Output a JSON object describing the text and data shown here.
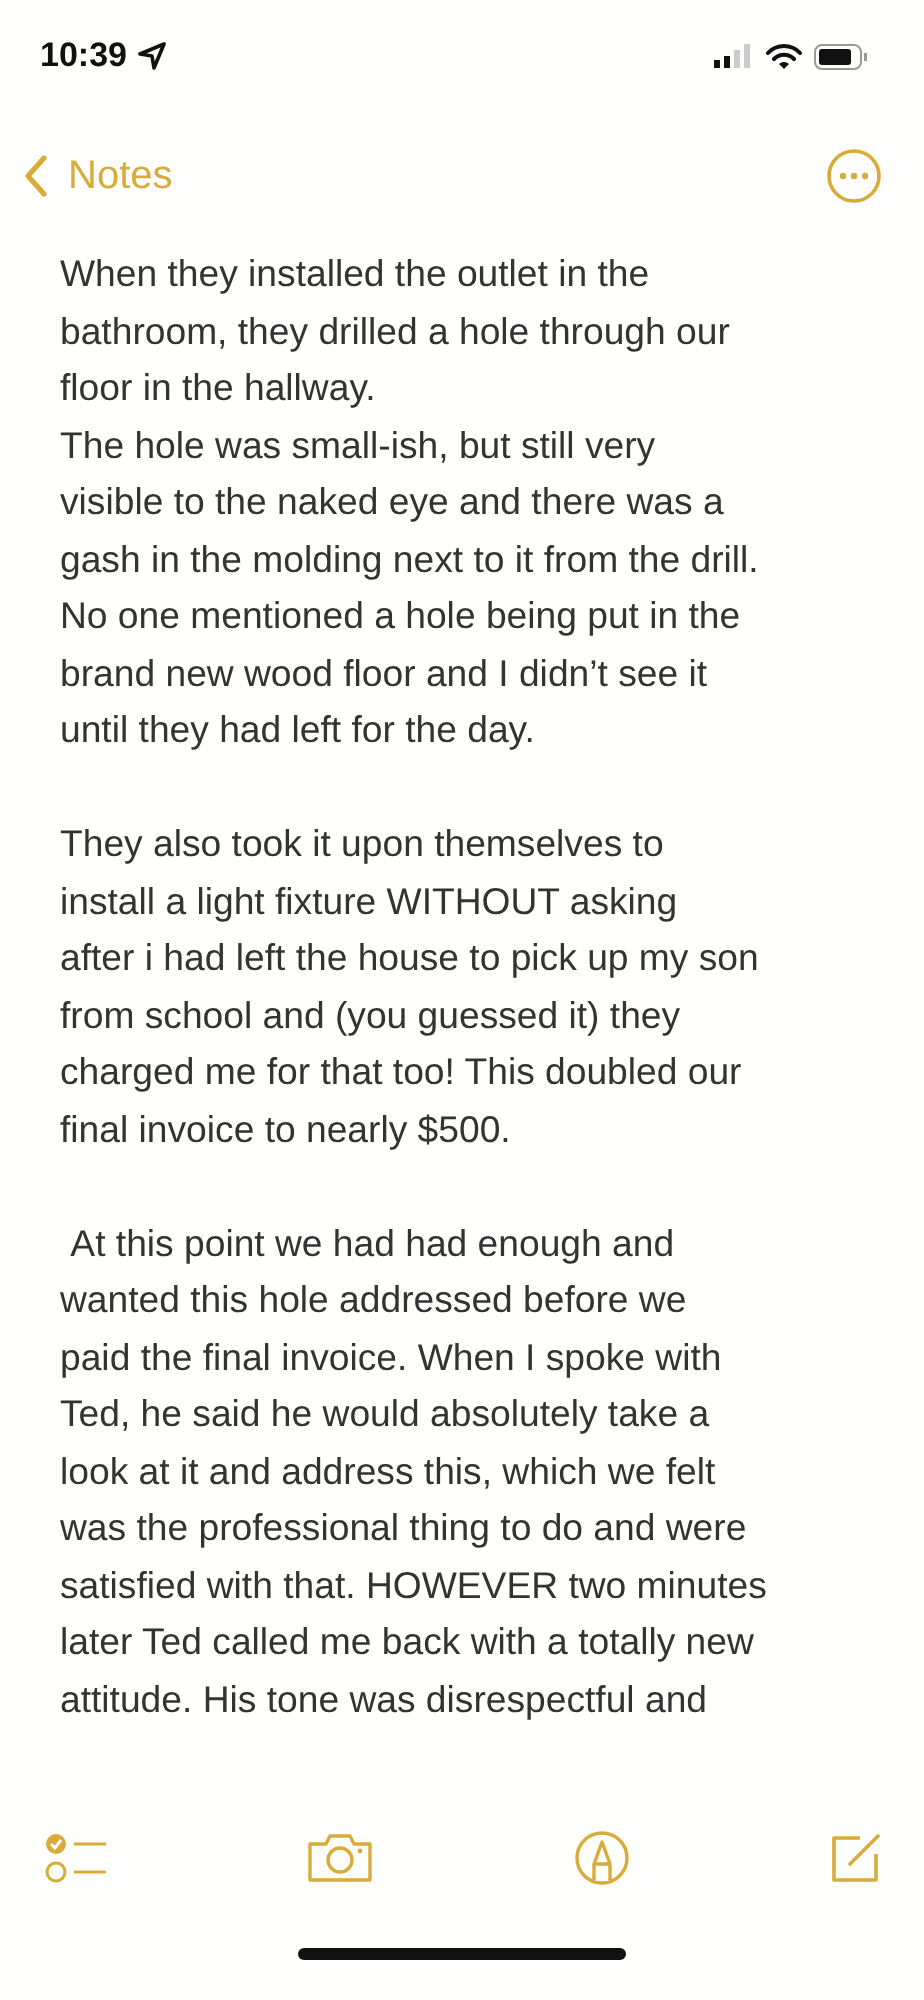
{
  "status_bar": {
    "time": "10:39"
  },
  "nav": {
    "back_label": "Notes"
  },
  "note": {
    "paragraphs": [
      "When they installed the outlet in the\nbathroom, they drilled a hole through our\nfloor in the hallway.\nThe hole was small-ish, but still very\nvisible to the naked eye and there was a\ngash in the molding next to it from the drill.\nNo one mentioned a hole being put in the\nbrand new wood floor and I didn’t see it\nuntil they had left for the day.",
      "They also took it upon themselves to\ninstall a light fixture WITHOUT asking\nafter i had left the house to pick up my son\nfrom school and (you guessed it) they\ncharged me for that too! This doubled our\nfinal invoice to nearly $500.",
      " At this point we had had enough and\nwanted this hole addressed before we\npaid the final invoice. When I spoke with\nTed, he said he would absolutely take a\nlook at it and address this, which we felt\nwas the professional thing to do and were\nsatisfied with that. HOWEVER two minutes\nlater Ted called me back with a totally new\nattitude. His tone was disrespectful and"
    ]
  }
}
